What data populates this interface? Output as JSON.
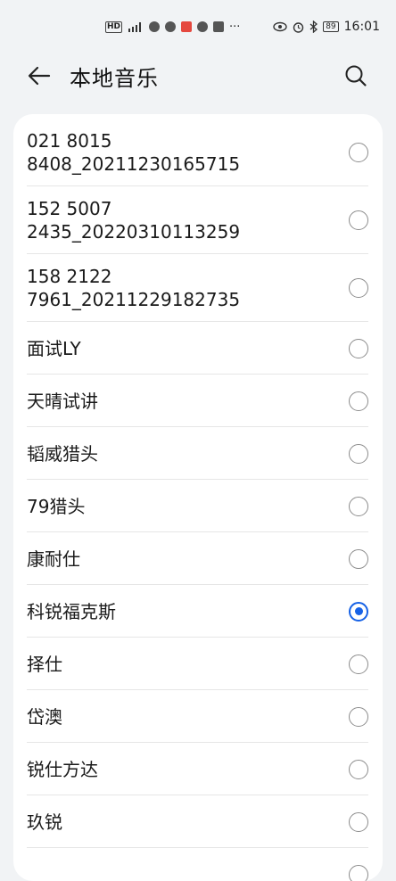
{
  "status_bar": {
    "time": "16:01",
    "battery": "89",
    "network": "HD"
  },
  "header": {
    "title": "本地音乐"
  },
  "list": {
    "items": [
      {
        "label": "021 8015\n8408_20211230165715",
        "selected": false
      },
      {
        "label": "152 5007\n2435_20220310113259",
        "selected": false
      },
      {
        "label": "158 2122\n7961_20211229182735",
        "selected": false
      },
      {
        "label": "面试LY",
        "selected": false
      },
      {
        "label": "天晴试讲",
        "selected": false
      },
      {
        "label": "韬威猎头",
        "selected": false
      },
      {
        "label": "79猎头",
        "selected": false
      },
      {
        "label": "康耐仕",
        "selected": false
      },
      {
        "label": "科锐福克斯",
        "selected": true
      },
      {
        "label": "择仕",
        "selected": false
      },
      {
        "label": "岱澳",
        "selected": false
      },
      {
        "label": "锐仕方达",
        "selected": false
      },
      {
        "label": "玖锐",
        "selected": false
      },
      {
        "label": "",
        "selected": false
      }
    ]
  },
  "colors": {
    "accent": "#1762e6",
    "background": "#f1f3f5",
    "card": "#ffffff"
  }
}
